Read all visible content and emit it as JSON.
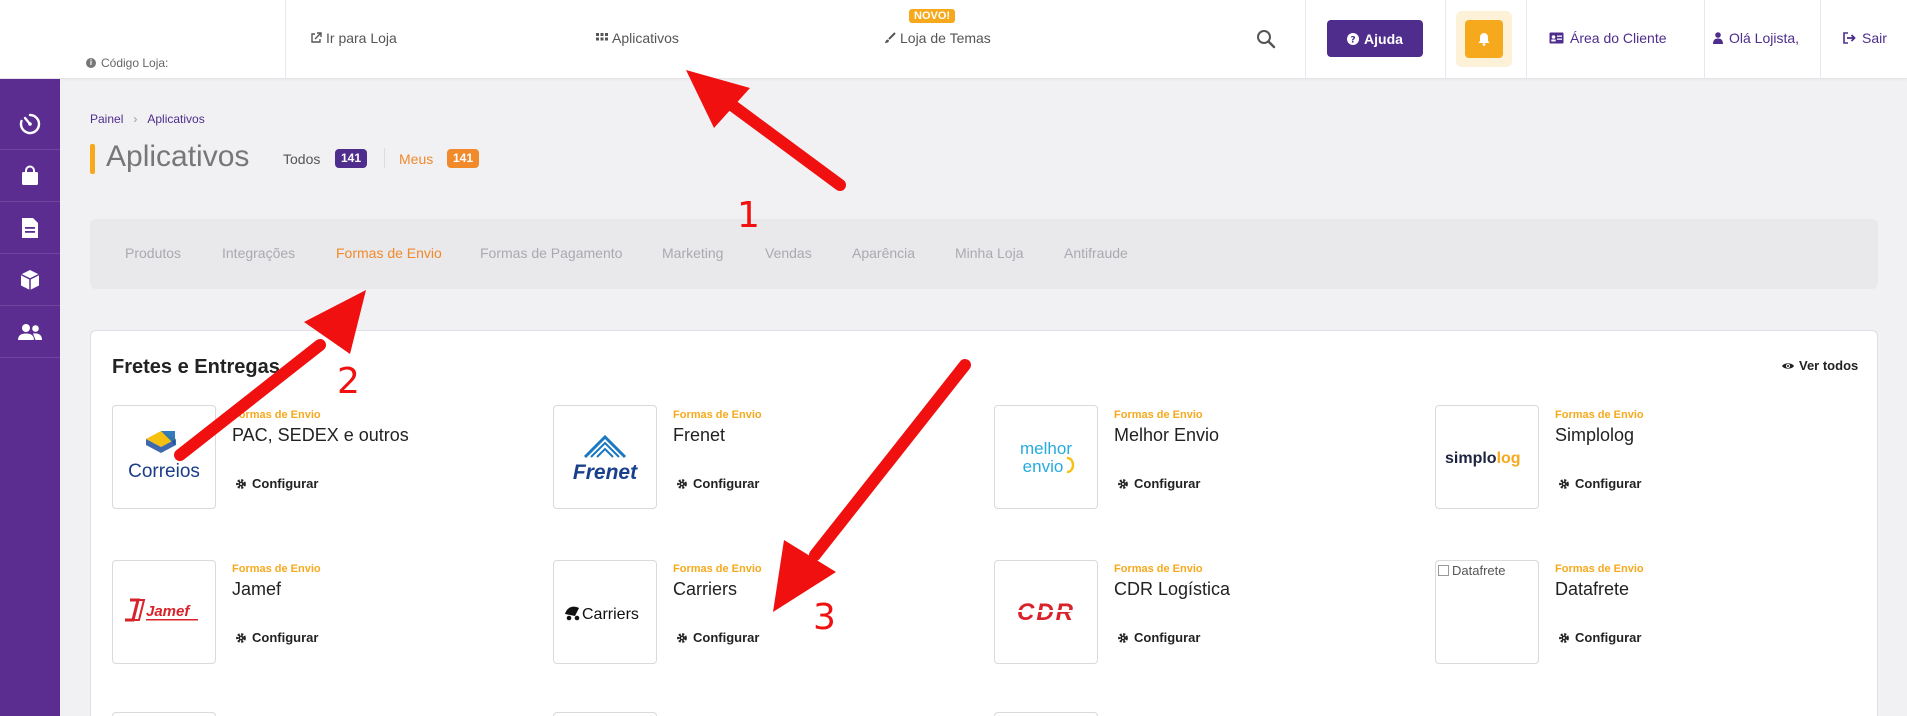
{
  "header": {
    "store_code_label": "Código Loja:",
    "links": {
      "go_to_store": "Ir para Loja",
      "apps": "Aplicativos",
      "themes": "Loja de Temas",
      "themes_badge": "NOVO!"
    },
    "help_label": "Ajuda",
    "client_area": "Área do Cliente",
    "greeting": "Olá Lojista,",
    "logout": "Sair"
  },
  "sidebar": {
    "items": [
      "dashboard-icon",
      "shopping-bag-icon",
      "document-icon",
      "box-icon",
      "users-icon"
    ]
  },
  "breadcrumb": [
    "Painel",
    "Aplicativos"
  ],
  "page": {
    "title": "Aplicativos",
    "all_label": "Todos",
    "all_count": "141",
    "mine_label": "Meus",
    "mine_count": "141"
  },
  "tabs": [
    "Produtos",
    "Integrações",
    "Formas de Envio",
    "Formas de Pagamento",
    "Marketing",
    "Vendas",
    "Aparência",
    "Minha Loja",
    "Antifraude"
  ],
  "active_tab": "Formas de Envio",
  "section": {
    "title": "Fretes e Entregas",
    "see_all": "Ver todos"
  },
  "cards": [
    {
      "category": "Formas de Envio",
      "name": "PAC, SEDEX e outros",
      "configure": "Configurar",
      "logo_text": "Correios"
    },
    {
      "category": "Formas de Envio",
      "name": "Frenet",
      "configure": "Configurar",
      "logo_text": "Frenet"
    },
    {
      "category": "Formas de Envio",
      "name": "Melhor Envio",
      "configure": "Configurar",
      "logo_text": "melhor envio"
    },
    {
      "category": "Formas de Envio",
      "name": "Simplolog",
      "configure": "Configurar",
      "logo_text": "simplolog"
    },
    {
      "category": "Formas de Envio",
      "name": "Jamef",
      "configure": "Configurar",
      "logo_text": "Jamef"
    },
    {
      "category": "Formas de Envio",
      "name": "Carriers",
      "configure": "Configurar",
      "logo_text": "Carriers"
    },
    {
      "category": "Formas de Envio",
      "name": "CDR Logística",
      "configure": "Configurar",
      "logo_text": "CDR"
    },
    {
      "category": "Formas de Envio",
      "name": "Datafrete",
      "configure": "Configurar",
      "logo_text": "Datafrete"
    }
  ],
  "annotations": [
    "1",
    "2",
    "3"
  ],
  "colors": {
    "brand_purple": "#5b2d90",
    "accent_orange": "#f6a91d",
    "active_tab": "#f08a2b",
    "arrow_red": "#f01010"
  }
}
